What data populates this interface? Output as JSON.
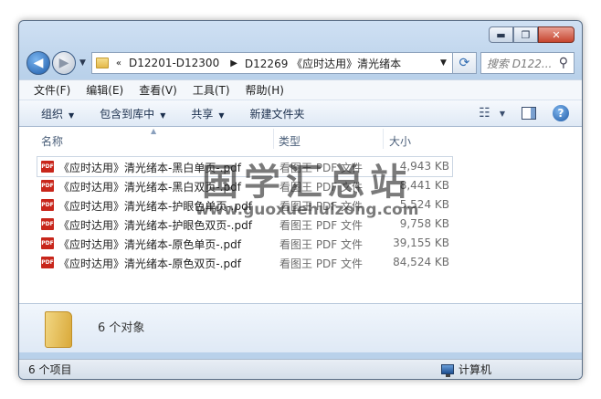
{
  "window": {
    "caption": {
      "minimize": "▬",
      "maximize": "❐",
      "close": "✕"
    }
  },
  "address": {
    "overflow": "«",
    "segments": [
      "D12201-D12300",
      "D12269 《应时达用》清光绪本"
    ],
    "separator": "▶"
  },
  "search": {
    "placeholder": "搜索 D122..."
  },
  "menu": [
    "文件(F)",
    "编辑(E)",
    "查看(V)",
    "工具(T)",
    "帮助(H)"
  ],
  "toolbar": {
    "organize": "组织",
    "include_library": "包含到库中",
    "share": "共享",
    "new_folder": "新建文件夹"
  },
  "columns": {
    "name": "名称",
    "type": "类型",
    "size": "大小"
  },
  "files": [
    {
      "name": "《应时达用》清光绪本-黑白单页-.pdf",
      "type": "看图王 PDF 文件",
      "size": "4,943 KB"
    },
    {
      "name": "《应时达用》清光绪本-黑白双页-.pdf",
      "type": "看图王 PDF 文件",
      "size": "8,441 KB"
    },
    {
      "name": "《应时达用》清光绪本-护眼色单页-.pdf",
      "type": "看图王 PDF 文件",
      "size": "5,524 KB"
    },
    {
      "name": "《应时达用》清光绪本-护眼色双页-.pdf",
      "type": "看图王 PDF 文件",
      "size": "9,758 KB"
    },
    {
      "name": "《应时达用》清光绪本-原色单页-.pdf",
      "type": "看图王 PDF 文件",
      "size": "39,155 KB"
    },
    {
      "name": "《应时达用》清光绪本-原色双页-.pdf",
      "type": "看图王 PDF 文件",
      "size": "84,524 KB"
    }
  ],
  "icons": {
    "file": "pdf-file-icon",
    "pdf_label": "PDF"
  },
  "details": {
    "summary": "6 个对象"
  },
  "status": {
    "items": "6 个项目",
    "location": "计算机"
  },
  "watermark": {
    "title": "国学汇总站",
    "url": "www.guoxuehuizong.com"
  }
}
